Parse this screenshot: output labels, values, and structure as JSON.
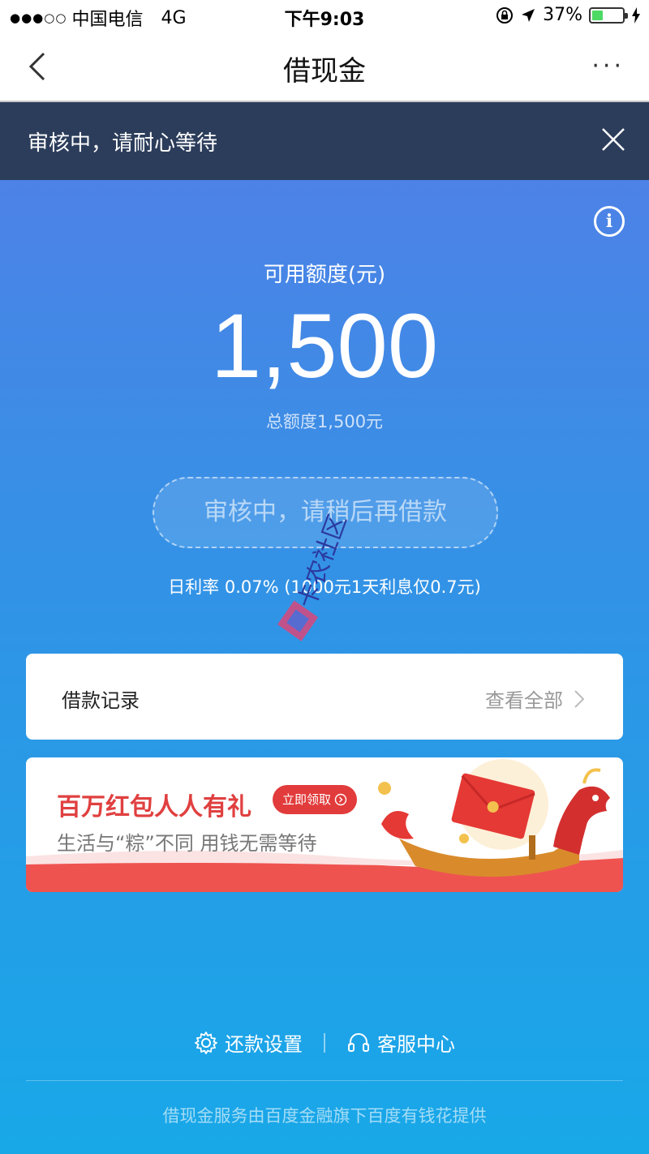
{
  "status_bar": {
    "signal": "●●●○○",
    "carrier": "中国电信",
    "network": "4G",
    "time": "下午9:03",
    "battery_percent": "37%",
    "battery_level": 0.37
  },
  "nav": {
    "title": "借现金",
    "more": "···"
  },
  "notice": {
    "text": "审核中，请耐心等待"
  },
  "credit": {
    "label": "可用额度(元)",
    "amount": "1,500",
    "total": "总额度1,500元",
    "status_button": "审核中，请稍后再借款",
    "rate": "日利率 0.07% (1000元1天利息仅0.7元)"
  },
  "watermark": {
    "text": "卡农社区"
  },
  "record": {
    "title": "借款记录",
    "link": "查看全部"
  },
  "promo": {
    "title": "百万红包人人有礼",
    "badge": "立即领取",
    "subtitle": "生活与“粽”不同 用钱无需等待"
  },
  "footer": {
    "repay_settings": "还款设置",
    "customer_service": "客服中心",
    "note": "借现金服务由百度金融旗下百度有钱花提供"
  },
  "colors": {
    "nav_dark": "#2c3d5b",
    "blue_top": "#4d82e6",
    "blue_bottom": "#18a8e8",
    "promo_red": "#e04040"
  }
}
